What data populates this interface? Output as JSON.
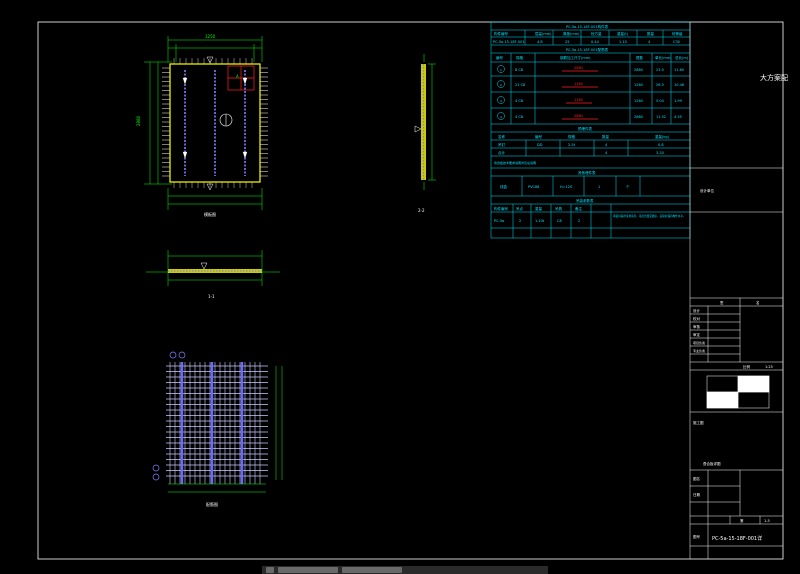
{
  "drawing": {
    "plan_title": "模板图",
    "rebar_title": "配筋图",
    "section_1_1": "1-1",
    "section_2_2": "2-2",
    "dimension_labels": [
      "170",
      "1250",
      "170",
      "2880",
      "1260",
      "260",
      "120"
    ]
  },
  "tables": {
    "component_table_title": "PC-5a-15-18F-001构件表",
    "component_headers": [
      "构件编号",
      "层高(mm)",
      "厚度(mm)",
      "砼方量",
      "重量(t)",
      "数量",
      "砼等级"
    ],
    "component_row": [
      "PC-5a-15-18F-001",
      "4.8",
      "25",
      "0.44",
      "1.10",
      "4",
      "C30"
    ],
    "rebar_table_title": "PC-5a-15-18F-001配筋表",
    "rebar_headers": [
      "编号",
      "规格",
      "钢筋加工尺寸(mm)",
      "根数",
      "单长(mm)",
      "总长(m)"
    ],
    "rebar_rows": [
      [
        "1",
        "8 C8",
        "2880",
        "2880",
        "23.0",
        "11.60"
      ],
      [
        "2",
        "21 C8",
        "1260",
        "1260",
        "26.5",
        "10.46"
      ],
      [
        "3",
        "4 C8",
        "1260",
        "1260",
        "5.04",
        "1.99"
      ],
      [
        "4",
        "4 C8",
        "2880",
        "2880",
        "11.52",
        "4.55"
      ]
    ],
    "embed_table_title": "预埋件表",
    "embed_headers": [
      "名称",
      "编号",
      "规格",
      "数量",
      "重量(kg)"
    ],
    "embed_row": [
      "吊钉",
      "DD",
      "2.5t",
      "4",
      "0.8"
    ],
    "embed_row2": [
      "合计",
      "",
      "",
      "4",
      "3.20"
    ],
    "note_text": "叠合板技术要求说明详见总说明",
    "misc_table_title": "其他埋件表",
    "misc_row": [
      "线盒",
      "PVC86",
      "H=120",
      "1",
      "个"
    ],
    "lift_table_title": "吊装参数表",
    "lift_headers": [
      "构件编号",
      "吊点",
      "重量",
      "吊具",
      "备注"
    ],
    "lift_row": [
      "PC-5a",
      "2",
      "1.10t",
      "C8",
      "2"
    ],
    "lift_note": "吊装时采用专用吊具，吊点位置见图示，起吊时保持构件水平。"
  },
  "title_block": {
    "company": "大方案配",
    "project_label": "设计单位",
    "sign_rows": [
      "设计",
      "校对",
      "审核",
      "审定",
      "项目负责",
      "专业负责"
    ],
    "header_cells": [
      "签",
      "名"
    ],
    "scale_label": "比例",
    "scale_value": "1:25",
    "drawing_name_label": "图名",
    "drawing_name": "叠合板详图",
    "drawing_no_label": "图号",
    "drawing_no": "PC-5a-15-18F-001详",
    "date_label": "日期",
    "phase": "施工图",
    "sheet_label": "第",
    "sheet_value": "1-5"
  },
  "colors": {
    "background": "#000000",
    "frame": "#ffffff",
    "dimension": "#00ff00",
    "table": "#00e5ff",
    "panel_edge": "#ffff00",
    "rebar": "#8080ff",
    "highlight": "#ff2020",
    "title_text": "#ffffff"
  },
  "taskbar": {
    "items": [
      "window-item",
      "window-item",
      "app-item"
    ]
  }
}
